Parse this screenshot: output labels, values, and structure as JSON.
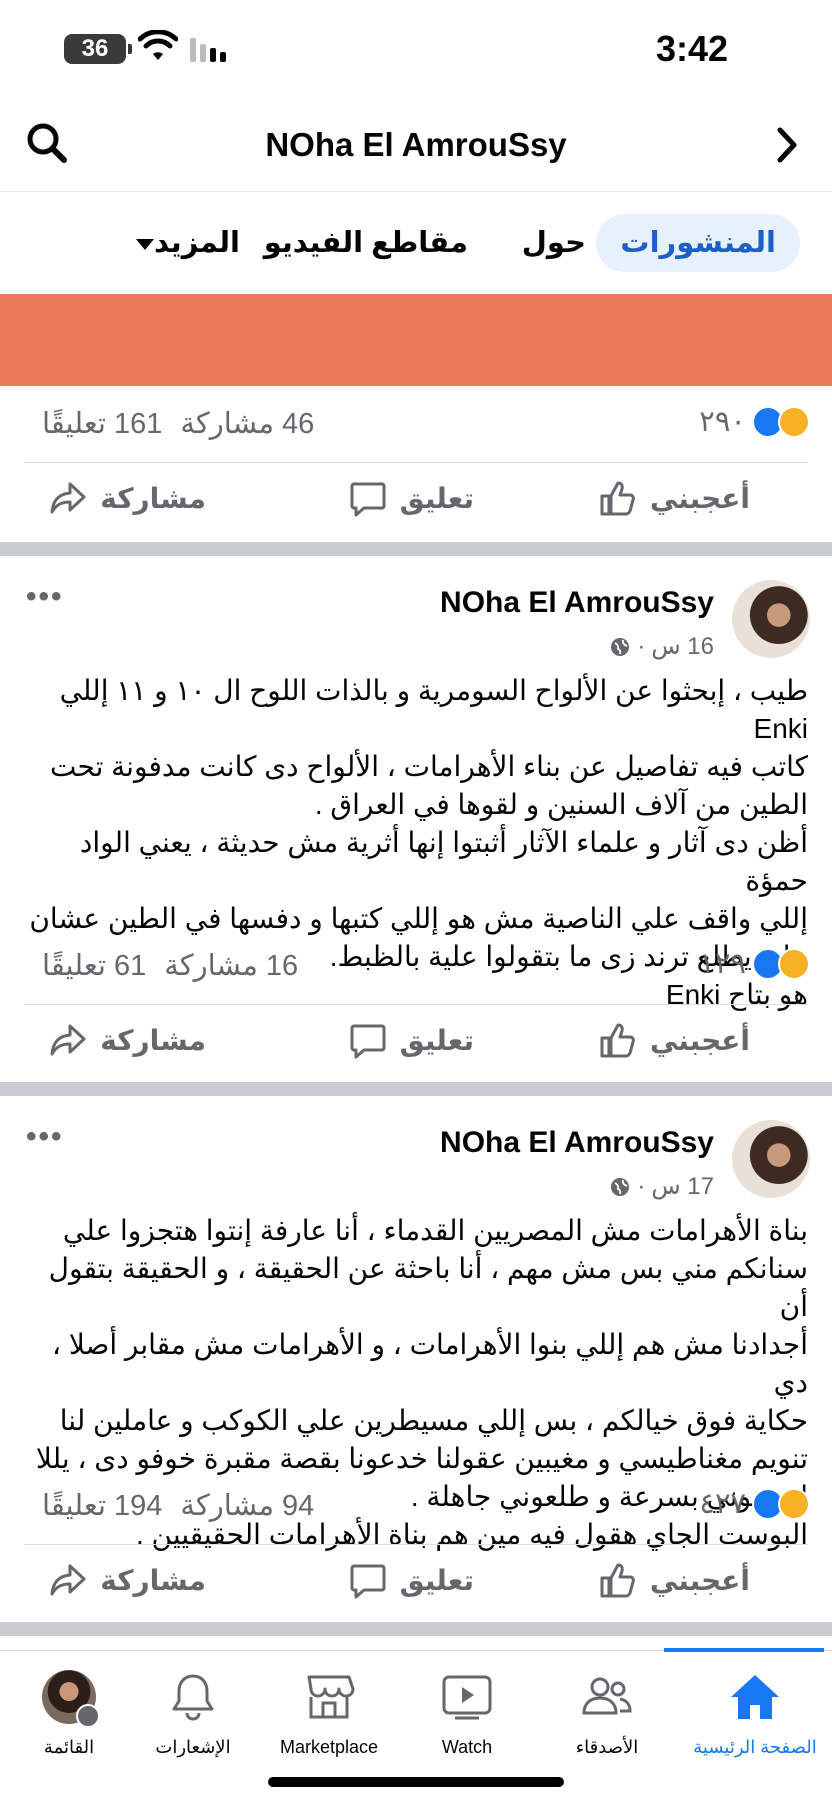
{
  "status_bar": {
    "battery": "36",
    "time": "3:42"
  },
  "header": {
    "title": "NOha El AmrouSsy"
  },
  "tabs": [
    {
      "label": "المنشورات",
      "active": true
    },
    {
      "label": "حول"
    },
    {
      "label": "مقاطع الفيديو"
    },
    {
      "label": "المزيد"
    }
  ],
  "post0": {
    "reactions": "٢٩٠",
    "shares": "46 مشاركة",
    "comments": "161 تعليقًا"
  },
  "actions": {
    "like": "أعجبني",
    "comment": "تعليق",
    "share": "مشاركة"
  },
  "posts": [
    {
      "author": "NOha El AmrouSsy",
      "time": "16 س",
      "body": "طيب ، إبحثوا عن الألواح السومرية و بالذات اللوح ال ١٠ و ١١ إللي Enki\nكاتب فيه تفاصيل عن بناء الأهرامات ، الألواح دى كانت مدفونة تحت\nالطين من آلاف السنين و لقوها في العراق .\nأظن دى آثار و علماء الآثار أثبتوا إنها أثرية مش حديثة ، يعني الواد حمؤة\nإللي واقف علي الناصية مش هو إللي كتبها و دفسها في الطين عشان\nعايز يطلع ترند زى ما بتقولوا علية بالظبط.\nهو بتاح Enki",
      "reactions": "١٢٩",
      "shares": "16 مشاركة",
      "comments": "61 تعليقًا"
    },
    {
      "author": "NOha El AmrouSsy",
      "time": "17 س",
      "body": "بناة الأهرامات مش المصريين القدماء ، أنا عارفة إنتوا هتجزوا علي\nسنانكم مني بس مش مهم ، أنا باحثة عن الحقيقة ، و الحقيقة بتقول أن\nأجدادنا مش هم إللي بنوا الأهرامات ، و الأهرامات مش مقابر أصلا ، دي\nحكاية فوق خيالكم ، بس إللي مسيطرين علي الكوكب و عاملين لنا\nتنويم مغناطيسي و مغيبين عقولنا خدعونا بقصة مقبرة خوفو دى ، يللا\nإشتموني بسرعة و طلعوني جاهلة .\nالبوست الجاي هقول فيه مين هم بناة الأهرامات الحقيقيين .",
      "reactions": "٤٢٧",
      "shares": "94 مشاركة",
      "comments": "194 تعليقًا"
    }
  ],
  "bottom_nav": {
    "home": "الصفحة الرئيسية",
    "friends": "الأصدقاء",
    "watch": "Watch",
    "marketplace": "Marketplace",
    "notifications": "الإشعارات",
    "menu": "القائمة"
  },
  "colors": {
    "accent": "#1877f2",
    "banner": "#e97856",
    "tab_active_bg": "#e7f0fd"
  },
  "icons": [
    "search-icon",
    "chevron-right-icon",
    "like-icon",
    "comment-icon",
    "share-icon",
    "globe-icon",
    "home-icon",
    "friends-icon",
    "watch-icon",
    "marketplace-icon",
    "bell-icon"
  ]
}
